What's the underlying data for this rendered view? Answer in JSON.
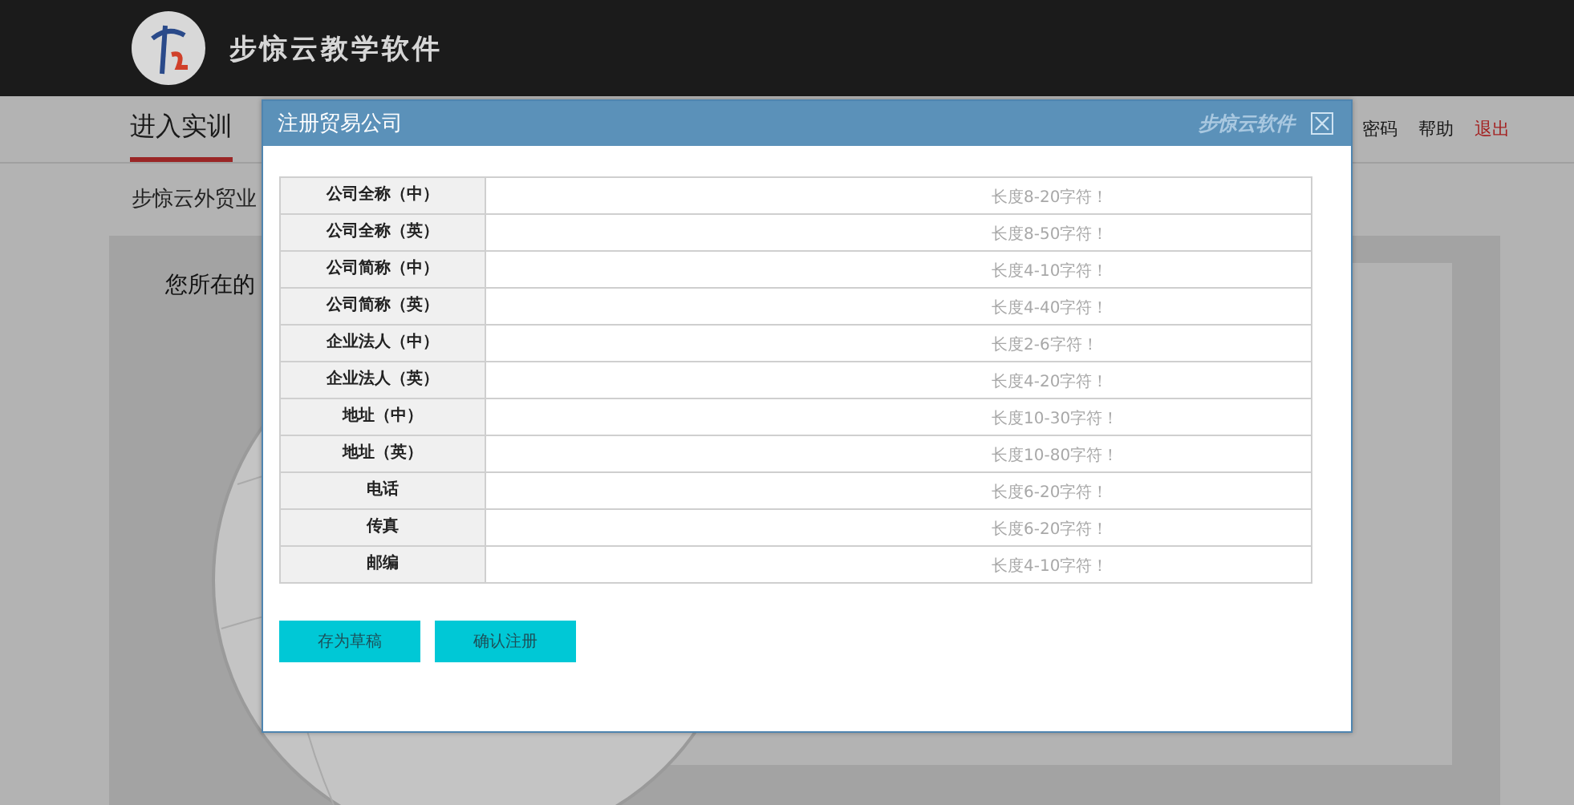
{
  "header": {
    "app_title": "步惊云教学软件"
  },
  "nav": {
    "tabs": [
      {
        "label": "进入实训",
        "selected": true
      }
    ],
    "links": [
      {
        "label": "密码",
        "kind": "normal"
      },
      {
        "label": "帮助",
        "kind": "normal"
      },
      {
        "label": "退出",
        "kind": "danger"
      }
    ]
  },
  "breadcrumb": "步惊云外贸业",
  "panel": {
    "heading": "您所在的"
  },
  "dialog": {
    "title": "注册贸易公司",
    "brand": "步惊云软件",
    "rows": [
      {
        "label": "公司全称（中）",
        "hint": "长度8-20字符！"
      },
      {
        "label": "公司全称（英）",
        "hint": "长度8-50字符！"
      },
      {
        "label": "公司简称（中）",
        "hint": "长度4-10字符！"
      },
      {
        "label": "公司简称（英）",
        "hint": "长度4-40字符！"
      },
      {
        "label": "企业法人（中）",
        "hint": "长度2-6字符！"
      },
      {
        "label": "企业法人（英）",
        "hint": "长度4-20字符！"
      },
      {
        "label": "地址（中）",
        "hint": "长度10-30字符！"
      },
      {
        "label": "地址（英）",
        "hint": "长度10-80字符！"
      },
      {
        "label": "电话",
        "hint": "长度6-20字符！"
      },
      {
        "label": "传真",
        "hint": "长度6-20字符！"
      },
      {
        "label": "邮编",
        "hint": "长度4-10字符！"
      }
    ],
    "buttons": [
      "存为草稿",
      "确认注册"
    ]
  }
}
